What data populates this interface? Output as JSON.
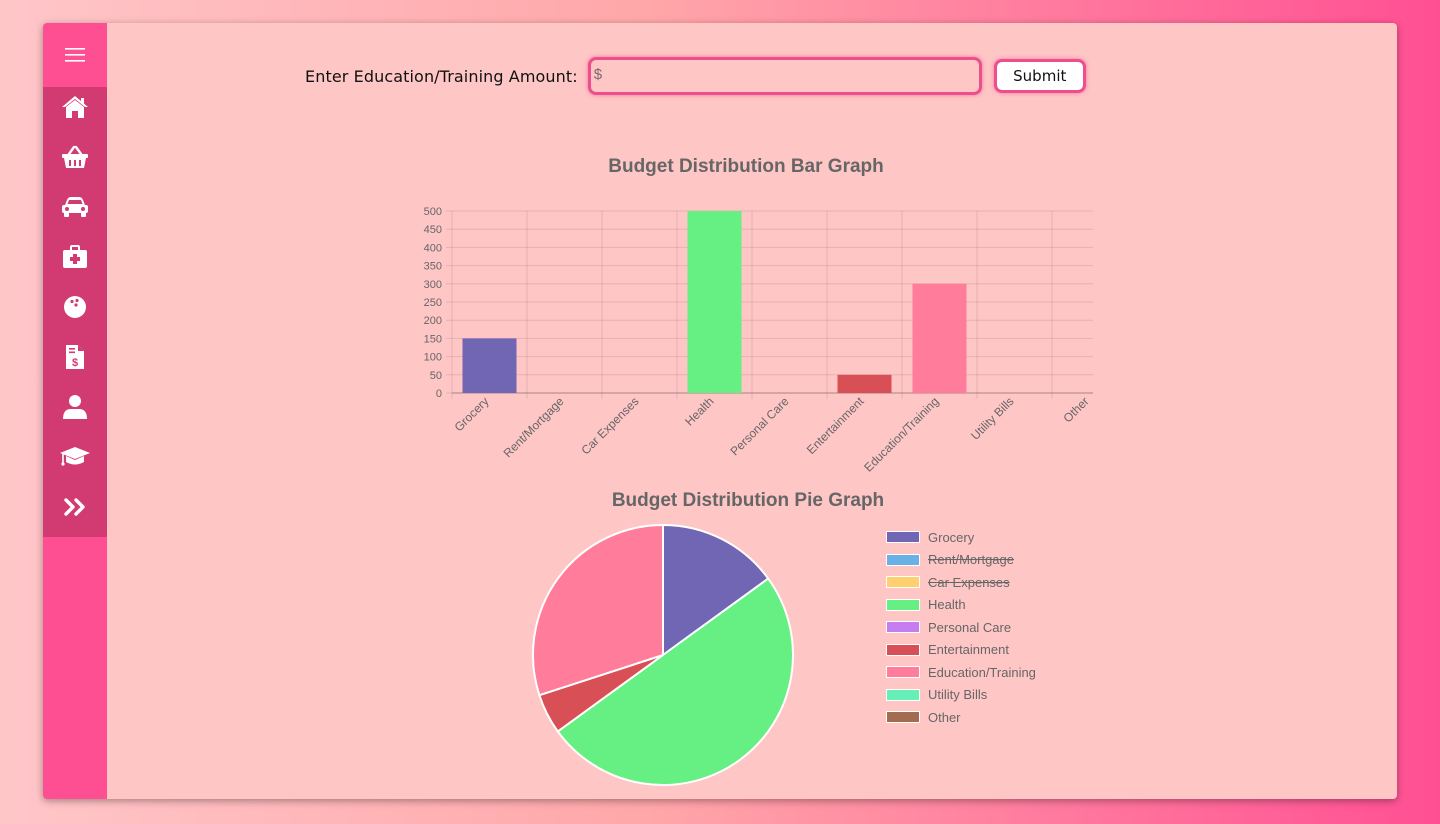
{
  "sidebar": {
    "menu_icon": "hamburger-icon",
    "items": [
      {
        "id": "home",
        "icon": "home-icon"
      },
      {
        "id": "grocery",
        "icon": "basket-icon"
      },
      {
        "id": "car",
        "icon": "car-icon"
      },
      {
        "id": "health",
        "icon": "medkit-icon"
      },
      {
        "id": "entertainment",
        "icon": "bowling-ball-icon"
      },
      {
        "id": "bills",
        "icon": "invoice-dollar-icon"
      },
      {
        "id": "personal-care",
        "icon": "user-icon"
      },
      {
        "id": "education",
        "icon": "graduation-cap-icon"
      },
      {
        "id": "other",
        "icon": "double-chevron-right-icon"
      }
    ]
  },
  "form": {
    "label": "Enter Education/Training Amount:",
    "currency_symbol": "$",
    "input_value": "",
    "submit_label": "Submit"
  },
  "colors": {
    "sidebar": "#ff4f93",
    "sidebar_strip": "#d23a72",
    "panel": "#ffc6c6",
    "accent": "#ec4f8c"
  },
  "chart_data": [
    {
      "type": "bar",
      "title": "Budget Distribution Bar Graph",
      "categories": [
        "Grocery",
        "Rent/Mortgage",
        "Car Expenses",
        "Health",
        "Personal Care",
        "Entertainment",
        "Education/Training",
        "Utility Bills",
        "Other"
      ],
      "values": [
        150,
        0,
        0,
        500,
        0,
        50,
        300,
        0,
        0
      ],
      "colors": [
        "#7066b3",
        "#6cb0e6",
        "#ffd06e",
        "#66ef82",
        "#c47ef0",
        "#d94f56",
        "#ff7c9a",
        "#66efb7",
        "#a36b50"
      ],
      "ylim": [
        0,
        500
      ],
      "yticks": [
        0,
        50,
        100,
        150,
        200,
        250,
        300,
        350,
        400,
        450,
        500
      ],
      "grid": true
    },
    {
      "type": "pie",
      "title": "Budget Distribution Pie Graph",
      "labels": [
        "Grocery",
        "Rent/Mortgage",
        "Car Expenses",
        "Health",
        "Personal Care",
        "Entertainment",
        "Education/Training",
        "Utility Bills",
        "Other"
      ],
      "values": [
        150,
        0,
        0,
        500,
        0,
        50,
        300,
        0,
        0
      ],
      "colors": [
        "#7066b3",
        "#6cb0e6",
        "#ffd06e",
        "#66ef82",
        "#c47ef0",
        "#d94f56",
        "#ff7c9a",
        "#66efb7",
        "#a36b50"
      ],
      "hidden": [
        false,
        true,
        true,
        false,
        false,
        false,
        false,
        false,
        false
      ],
      "legend_position": "right"
    }
  ]
}
